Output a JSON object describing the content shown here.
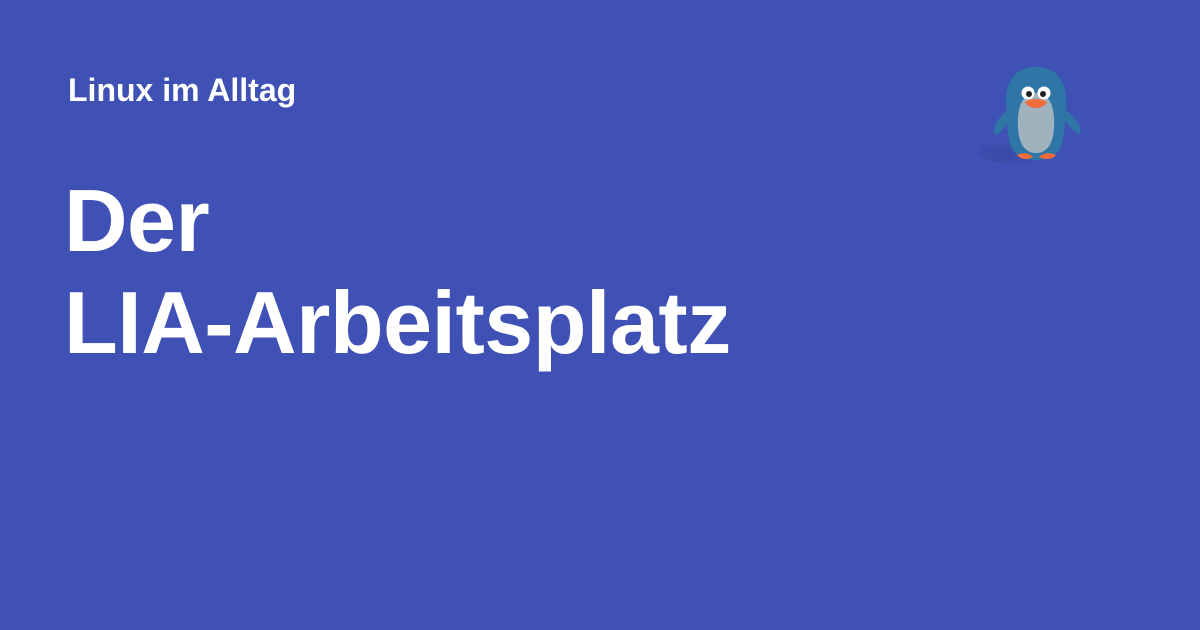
{
  "colors": {
    "background": "#3f51b5",
    "text": "#ffffff",
    "penguin_body": "#2f76a6",
    "penguin_belly": "#9fb3bf",
    "penguin_beak": "#f26b3a",
    "penguin_feet": "#f26b3a"
  },
  "header": {
    "site_name": "Linux im Alltag"
  },
  "title": {
    "line1": "Der",
    "line2": "LIA-Arbeitsplatz"
  },
  "mascot": {
    "icon": "penguin-icon"
  }
}
